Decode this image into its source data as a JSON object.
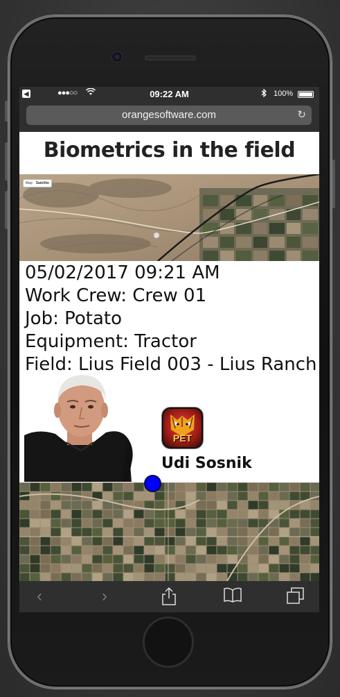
{
  "status_bar": {
    "signal": "●●●○○",
    "time": "09:22 AM",
    "bluetooth_icon": "bluetooth-icon",
    "battery_percent": "100%",
    "battery_level": 1.0
  },
  "browser": {
    "url": "orangesoftware.com",
    "reload_icon": "reload-icon"
  },
  "page": {
    "title": "Biometrics in the field",
    "map_top_toggle": {
      "map": "Map",
      "satellite": "Satellite"
    },
    "info_lines": [
      "05/02/2017  09:21 AM",
      "Work Crew: Crew 01",
      "Job: Potato",
      "Equipment: Tractor",
      "Field: Lius Field 003 - Lius Ranch"
    ],
    "app_icon_label": "PET",
    "person_name": "Udi Sosnik"
  },
  "toolbar": {
    "icons": [
      "back-icon",
      "forward-icon",
      "share-icon",
      "bookmarks-icon",
      "tabs-icon"
    ]
  },
  "colors": {
    "pin": "#0000ff",
    "chrome": "#2f2f2f",
    "url_bar": "#5a5a5a"
  }
}
